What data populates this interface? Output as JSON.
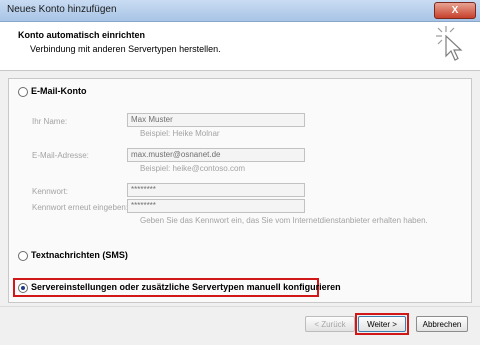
{
  "window": {
    "title": "Neues Konto hinzufügen",
    "close_label": "X"
  },
  "header": {
    "title": "Konto automatisch einrichten",
    "subtitle": "Verbindung mit anderen Servertypen herstellen.",
    "icon": "cursor-sparkle-icon"
  },
  "options": {
    "email": {
      "label": "E-Mail-Konto",
      "selected": false
    },
    "sms": {
      "label": "Textnachrichten (SMS)",
      "selected": false
    },
    "manual": {
      "label": "Servereinstellungen oder zusätzliche Servertypen manuell konfigurieren",
      "selected": true
    }
  },
  "form": {
    "name_label": "Ihr Name:",
    "name_value": "Max Muster",
    "name_hint": "Beispiel: Heike Molnar",
    "email_label": "E-Mail-Adresse:",
    "email_value": "max.muster@osnanet.de",
    "email_hint": "Beispiel: heike@contoso.com",
    "password_label": "Kennwort:",
    "password_value": "********",
    "password_repeat_label": "Kennwort erneut eingeben:",
    "password_repeat_value": "********",
    "password_hint": "Geben Sie das Kennwort ein, das Sie vom Internetdienstanbieter erhalten haben."
  },
  "buttons": {
    "back": "< Zurück",
    "next": "Weiter >",
    "cancel": "Abbrechen"
  },
  "colors": {
    "highlight": "#d01818",
    "accent": "#1f3c8a"
  }
}
